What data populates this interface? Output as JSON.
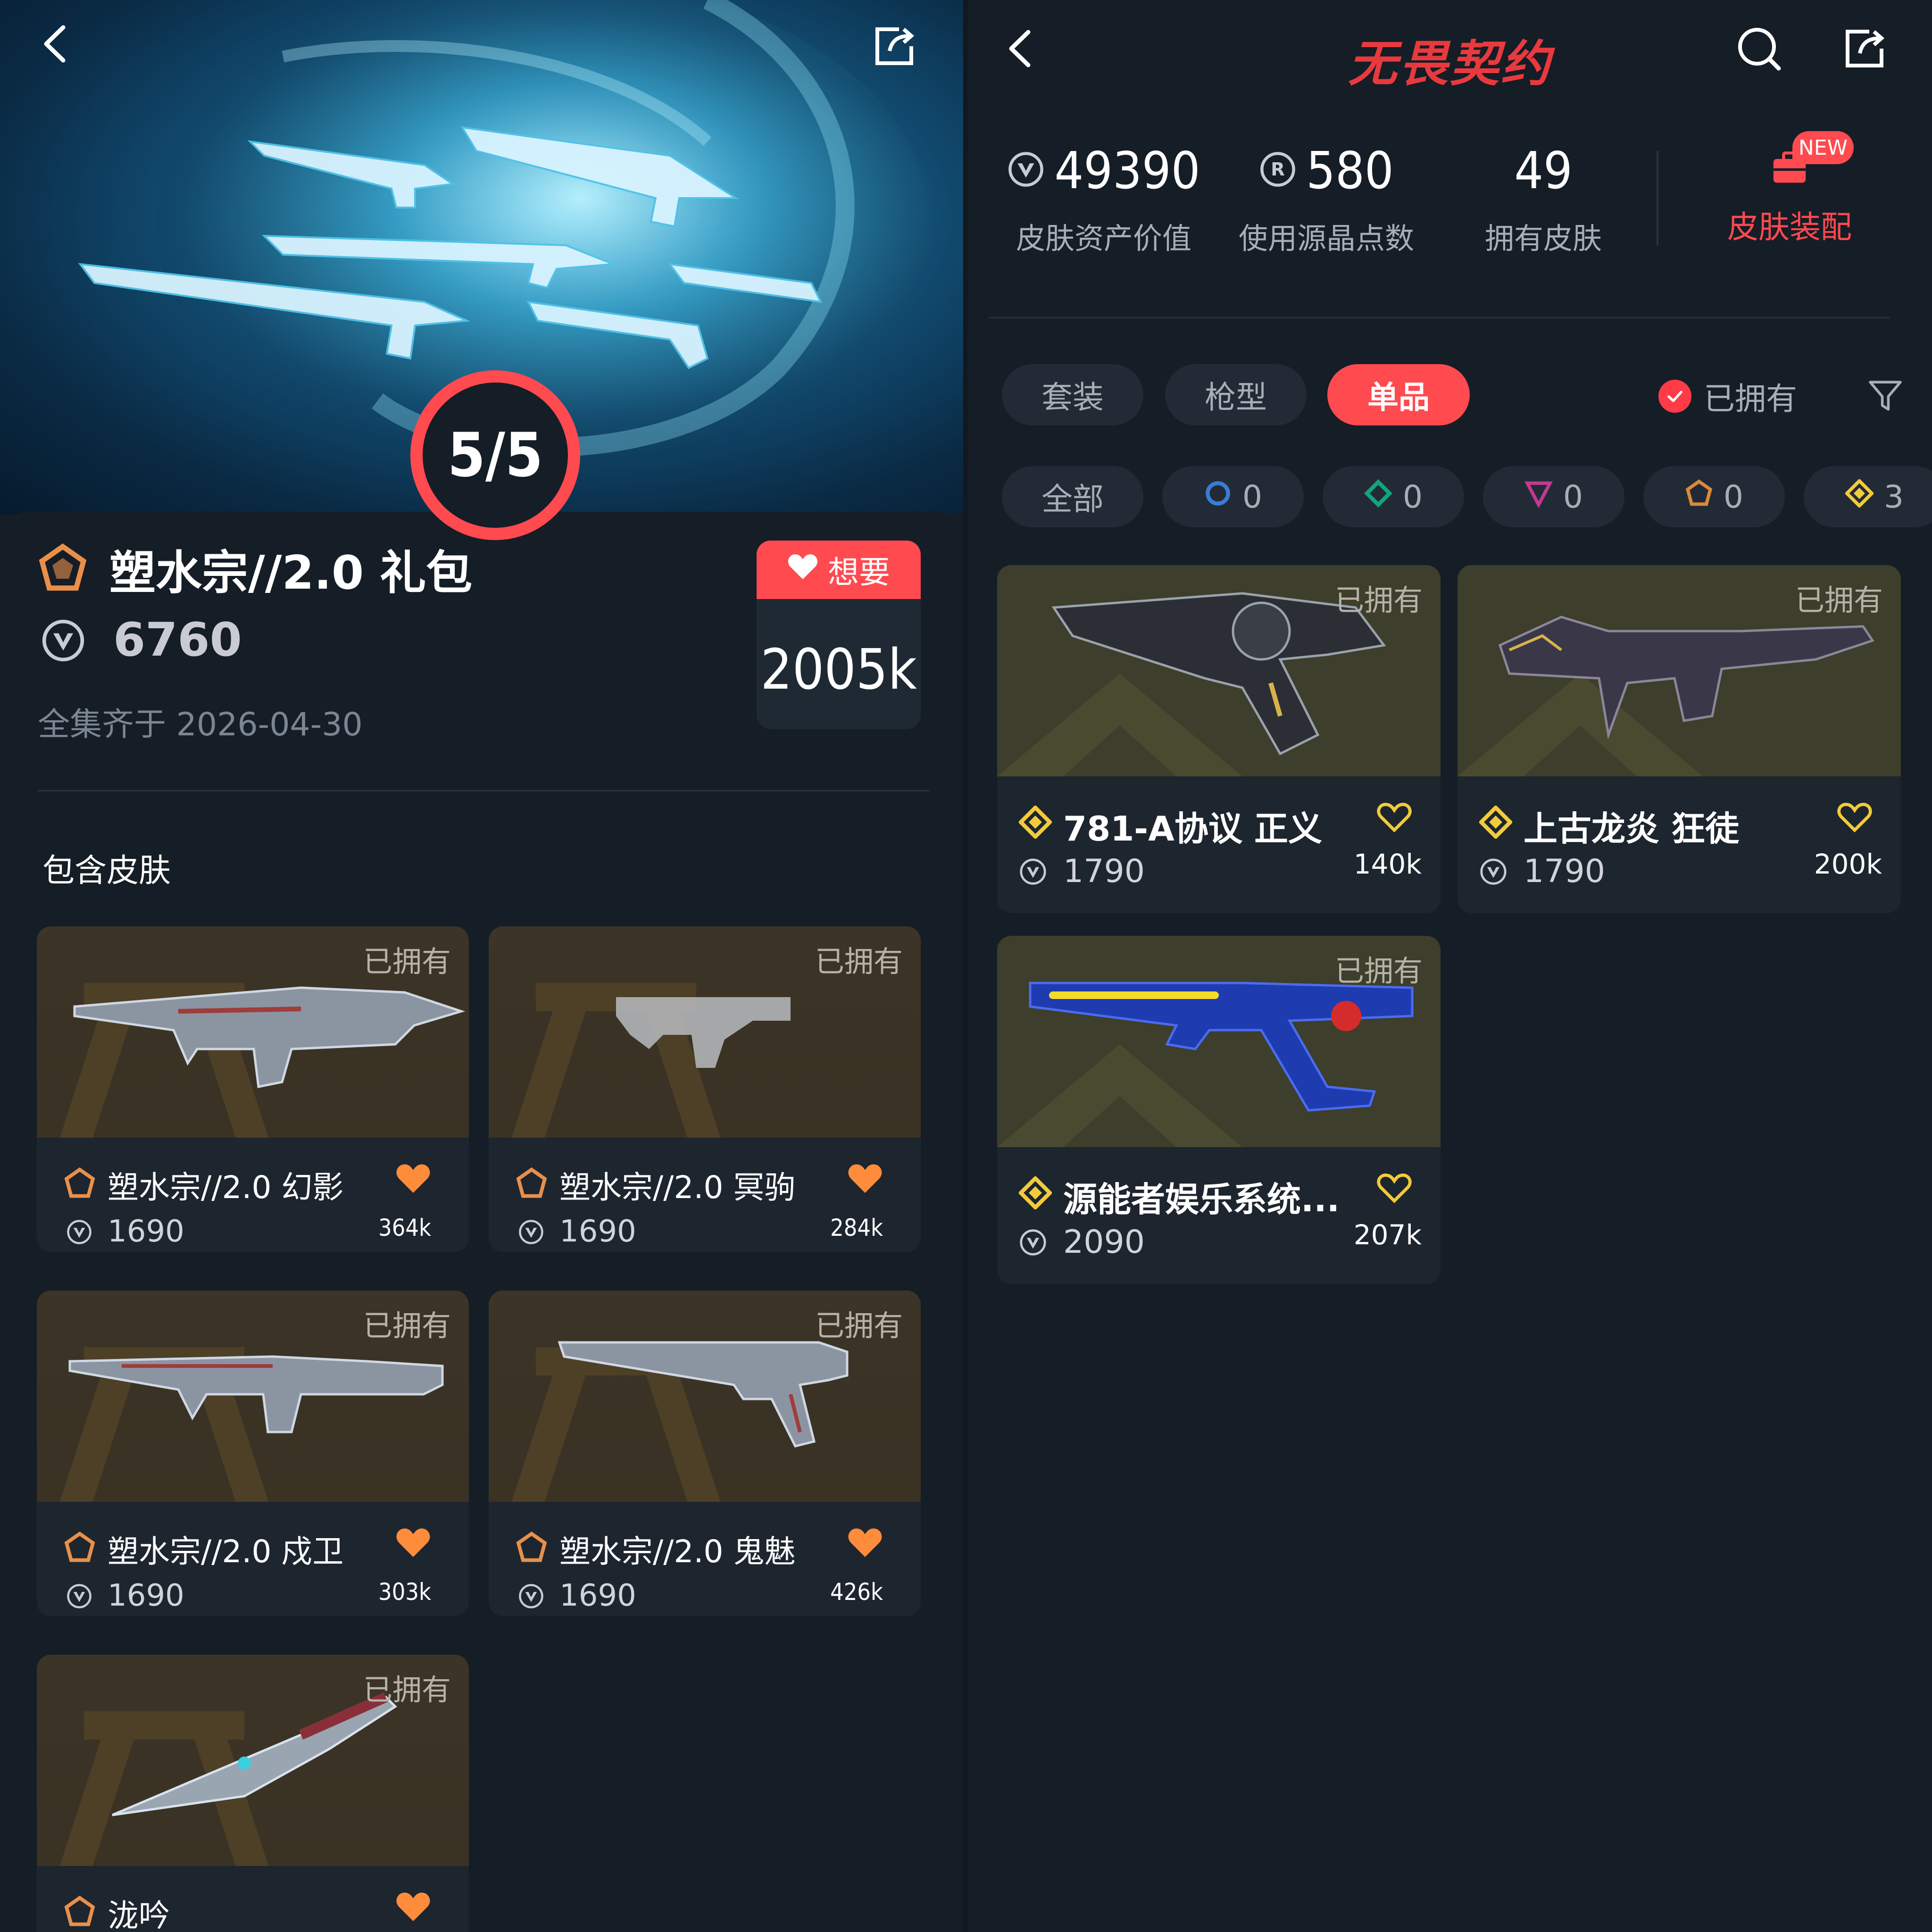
{
  "bundle": {
    "progress": "5/5",
    "title": "塑水宗//2.0 礼包",
    "price": "6760",
    "completed_date": "全集齐于 2026-04-30",
    "want_label": "想要",
    "want_count": "2005k",
    "section_label": "包含皮肤",
    "skins": [
      {
        "name": "塑水宗//2.0 幻影",
        "price": "1690",
        "likes": "364k",
        "owned": "已拥有"
      },
      {
        "name": "塑水宗//2.0 冥驹",
        "price": "1690",
        "likes": "284k",
        "owned": "已拥有"
      },
      {
        "name": "塑水宗//2.0 戍卫",
        "price": "1690",
        "likes": "303k",
        "owned": "已拥有"
      },
      {
        "name": "塑水宗//2.0 鬼魅",
        "price": "1690",
        "likes": "426k",
        "owned": "已拥有"
      },
      {
        "name": "泷吟",
        "price": "",
        "likes": "",
        "owned": "已拥有"
      }
    ]
  },
  "collection": {
    "app_title": "无畏契约",
    "stats": [
      {
        "value": "49390",
        "label": "皮肤资产价值",
        "icon": "vp-icon"
      },
      {
        "value": "580",
        "label": "使用源晶点数",
        "icon": "radianite-icon"
      },
      {
        "value": "49",
        "label": "拥有皮肤",
        "icon": ""
      }
    ],
    "loadout_label": "皮肤装配",
    "new_badge": "NEW",
    "tabs": [
      "套装",
      "枪型",
      "单品"
    ],
    "active_tab": "单品",
    "owned_filter": "已拥有",
    "rarity_filters": [
      {
        "label": "全部",
        "count": ""
      },
      {
        "label": "",
        "count": "0",
        "icon": "select-tier-icon",
        "color": "#3a7bd5"
      },
      {
        "label": "",
        "count": "0",
        "icon": "deluxe-tier-icon",
        "color": "#14a37f"
      },
      {
        "label": "",
        "count": "0",
        "icon": "premium-tier-icon",
        "color": "#c03a8f"
      },
      {
        "label": "",
        "count": "0",
        "icon": "ultra-tier-icon",
        "color": "#d98a3b"
      },
      {
        "label": "",
        "count": "3",
        "icon": "exclusive-tier-icon",
        "color": "#f2cb3b"
      }
    ],
    "items": [
      {
        "name": "781-A协议 正义",
        "price": "1790",
        "likes": "140k",
        "owned": "已拥有"
      },
      {
        "name": "上古龙炎 狂徒",
        "price": "1790",
        "likes": "200k",
        "owned": "已拥有"
      },
      {
        "name": "源能者娱乐系统...",
        "price": "2090",
        "likes": "207k",
        "owned": "已拥有"
      }
    ]
  },
  "colors": {
    "accent": "#ff4a50",
    "ultra_tier": "#e8904a",
    "exclusive_tier": "#f2cb3b",
    "background": "#151d26",
    "card": "#1d252f"
  }
}
